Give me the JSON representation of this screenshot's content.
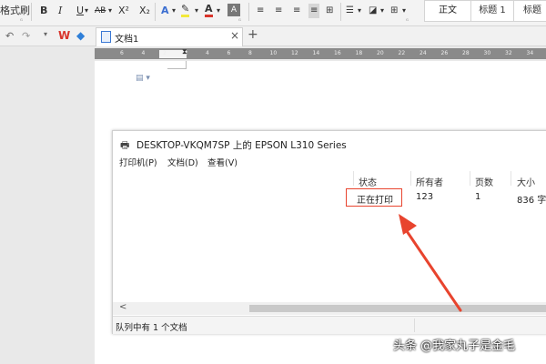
{
  "ribbon": {
    "format_brush_label": "格式刷",
    "bold": "B",
    "italic": "I",
    "underline": "U",
    "strikethrough": "AB",
    "superscript": "X²",
    "subscript": "X₂",
    "font_color_glyph": "A",
    "highlight_glyph": "A",
    "char_shading_glyph": "A",
    "styles": [
      "正文",
      "标题 1",
      "标题"
    ]
  },
  "tabbar": {
    "doc_tab_label": "文档1",
    "close_glyph": "×",
    "new_tab_glyph": "+"
  },
  "ruler": {
    "ticks": [
      "6",
      "4",
      "2",
      "2",
      "4",
      "6",
      "8",
      "10",
      "12",
      "14",
      "16",
      "18",
      "20",
      "22",
      "24",
      "26",
      "28",
      "30",
      "32",
      "34"
    ]
  },
  "dialog": {
    "title": "DESKTOP-VKQM7SP 上的 EPSON L310 Series",
    "menu": [
      "打印机(P)",
      "文档(D)",
      "查看(V)"
    ],
    "columns": [
      "状态",
      "所有者",
      "页数",
      "大小"
    ],
    "row": {
      "status": "正在打印",
      "owner": "123",
      "pages": "1",
      "size": "836 字"
    },
    "status_bar": "队列中有 1 个文档",
    "scroll_left": "<"
  },
  "watermark": "头条 @我家丸子是金毛",
  "colors": {
    "highlight_box": "#e8442e",
    "arrow": "#e8442e",
    "wps_red": "#d9342b"
  }
}
